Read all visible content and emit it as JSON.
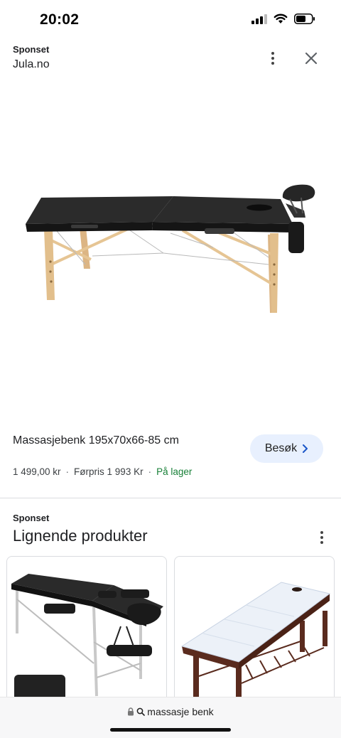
{
  "status_bar": {
    "time": "20:02"
  },
  "ad": {
    "sponsored": "Sponset",
    "seller": "Jula.no",
    "icons": {
      "more": "more-vert-icon",
      "close": "close-icon"
    }
  },
  "product": {
    "title": "Massasjebenk 195x70x66-85 cm",
    "visit_label": "Besøk",
    "price": "1 499,00 kr",
    "separator": "·",
    "previous_price": "Førpris 1 993 Kr",
    "stock": "På lager",
    "image": "massage-table-image"
  },
  "similar": {
    "sponsored": "Sponset",
    "title": "Lignende produkter",
    "cards": [
      {
        "image": "black-massage-table-image"
      },
      {
        "image": "white-sheet-massage-bed-image"
      }
    ]
  },
  "bottom_bar": {
    "url": "massasje benk"
  },
  "colors": {
    "accent_blue_bg": "#e8f0fe",
    "stock_green": "#188038",
    "wood": "#e2bf8c",
    "table_black": "#1f1f1f"
  }
}
